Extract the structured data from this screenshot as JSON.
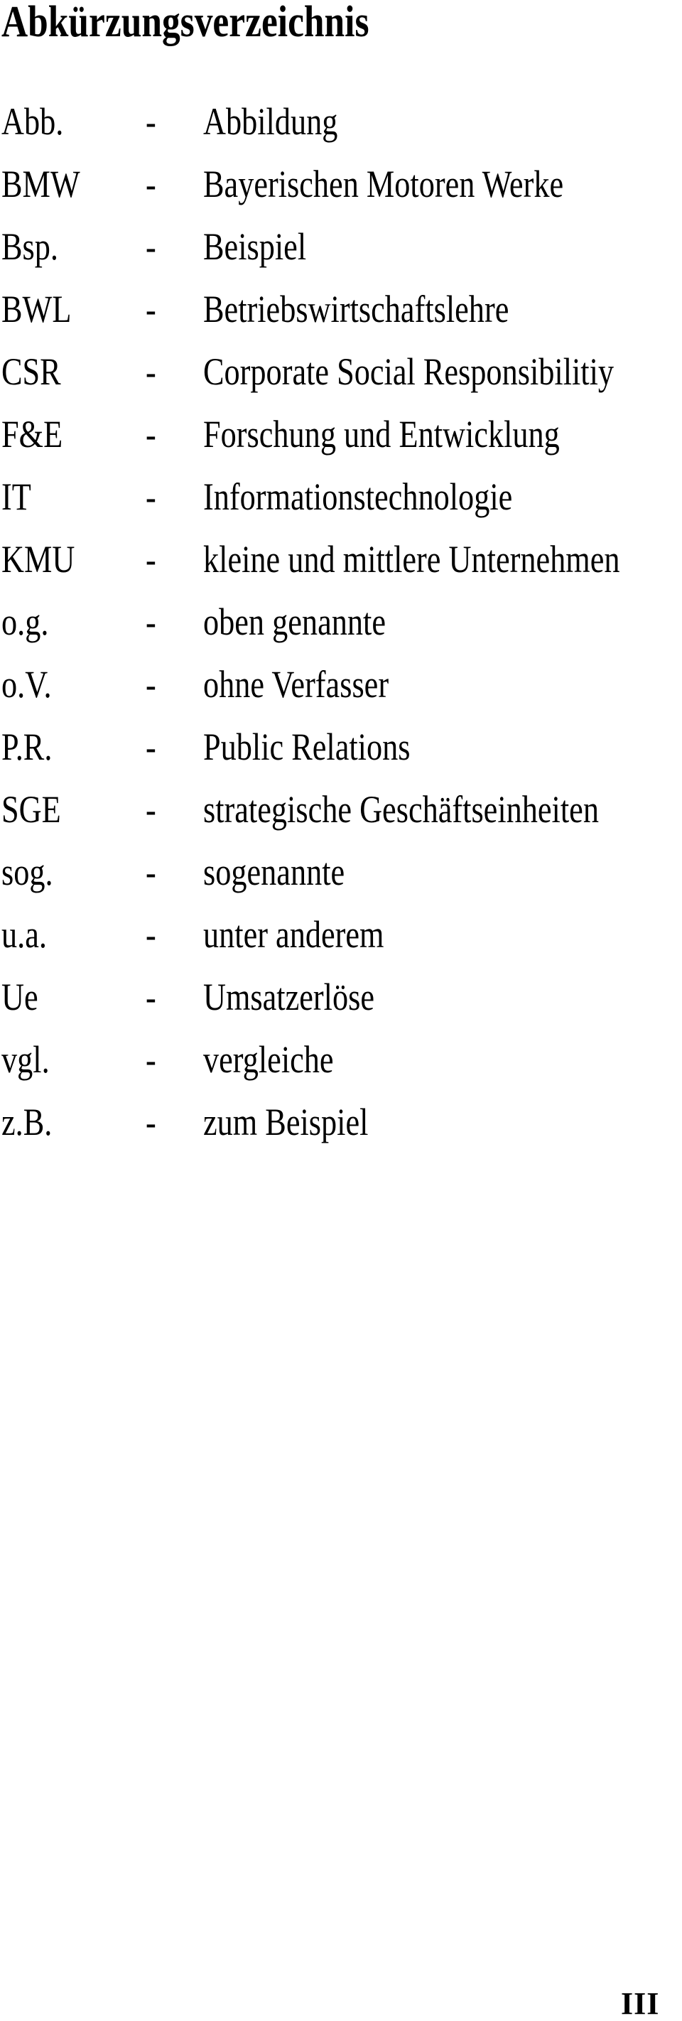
{
  "page": {
    "title": "Abkürzungsverzeichnis",
    "separator": "-",
    "page_number": "III"
  },
  "abbreviations": [
    {
      "abbr": "Abb.",
      "meaning": "Abbildung"
    },
    {
      "abbr": "BMW",
      "meaning": "Bayerischen Motoren Werke"
    },
    {
      "abbr": "Bsp.",
      "meaning": "Beispiel"
    },
    {
      "abbr": "BWL",
      "meaning": "Betriebswirtschaftslehre"
    },
    {
      "abbr": "CSR",
      "meaning": "Corporate Social Responsibilitiy"
    },
    {
      "abbr": "F&E",
      "meaning": "Forschung und Entwicklung"
    },
    {
      "abbr": "IT",
      "meaning": "Informationstechnologie"
    },
    {
      "abbr": "KMU",
      "meaning": "kleine und mittlere Unternehmen"
    },
    {
      "abbr": "o.g.",
      "meaning": "oben genannte"
    },
    {
      "abbr": "o.V.",
      "meaning": "ohne Verfasser"
    },
    {
      "abbr": "P.R.",
      "meaning": "Public Relations"
    },
    {
      "abbr": "SGE",
      "meaning": "strategische Geschäftseinheiten"
    },
    {
      "abbr": "sog.",
      "meaning": "sogenannte"
    },
    {
      "abbr": "u.a.",
      "meaning": "unter anderem"
    },
    {
      "abbr": "Ue",
      "meaning": "Umsatzerlöse"
    },
    {
      "abbr": "vgl.",
      "meaning": "vergleiche"
    },
    {
      "abbr": "z.B.",
      "meaning": "zum Beispiel"
    }
  ]
}
